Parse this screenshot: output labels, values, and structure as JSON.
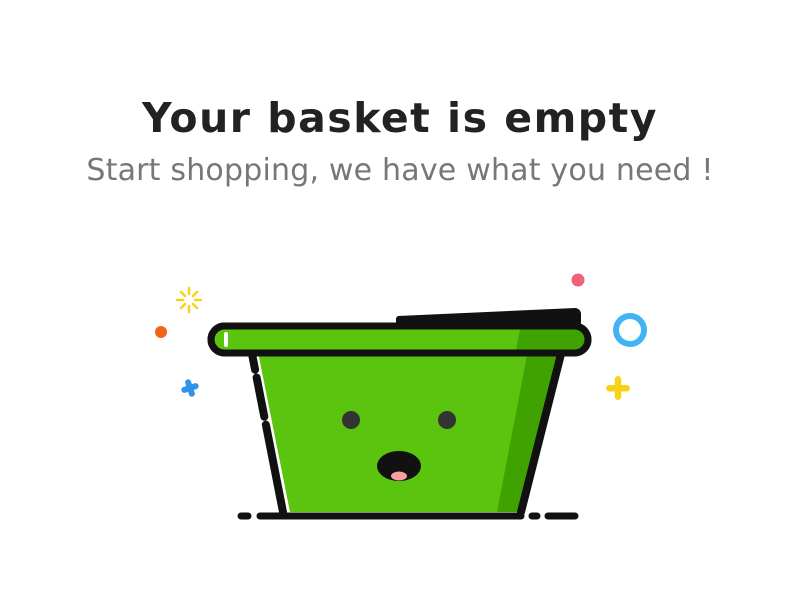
{
  "empty_state": {
    "title": "Your basket is empty",
    "subtitle": "Start shopping, we have what you need !"
  },
  "colors": {
    "basket_green": "#5AC40E",
    "basket_shade": "#3FA200",
    "outline": "#111111",
    "title_text": "#222222",
    "subtitle_text": "#777777",
    "sparkle_yellow": "#F8D21A",
    "dot_orange": "#F26419",
    "dot_pink": "#F06278",
    "ring_blue": "#42B4F5",
    "plus_blue": "#2F93E8",
    "plus_yellow": "#F8D21A"
  },
  "icons": {
    "basket": "empty-basket-icon",
    "sparkle": "sparkle-icon",
    "ring": "ring-icon",
    "plus": "plus-icon",
    "dot": "dot-icon"
  }
}
